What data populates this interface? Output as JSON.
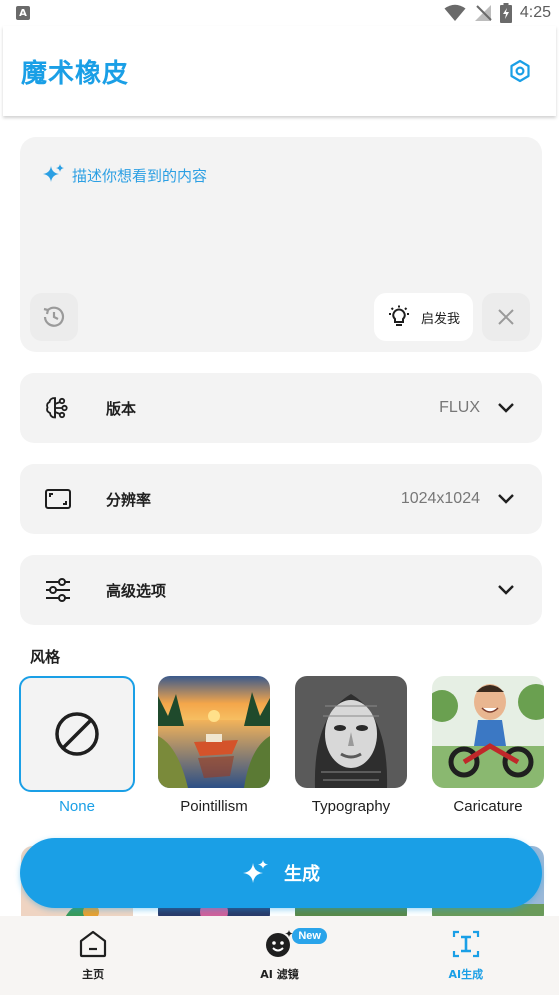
{
  "status_bar": {
    "time": "4:25",
    "notification_letter": "A"
  },
  "app": {
    "title": "魔术橡皮"
  },
  "prompt": {
    "placeholder": "描述你想看到的内容",
    "inspire_label": "启发我"
  },
  "options": [
    {
      "label": "版本",
      "value": "FLUX",
      "icon": "brain-icon"
    },
    {
      "label": "分辨率",
      "value": "1024x1024",
      "icon": "aspect-ratio-icon"
    },
    {
      "label": "高级选项",
      "value": "",
      "icon": "sliders-icon"
    }
  ],
  "styles": {
    "title": "风格",
    "items": [
      {
        "name": "None",
        "selected": true
      },
      {
        "name": "Pointillism",
        "selected": false
      },
      {
        "name": "Typography",
        "selected": false
      },
      {
        "name": "Caricature",
        "selected": false
      }
    ]
  },
  "generate": {
    "label": "生成"
  },
  "bottom_nav": {
    "items": [
      {
        "label": "主页",
        "icon": "home-icon",
        "active": false
      },
      {
        "label": "AI 滤镜",
        "icon": "face-sparkle-icon",
        "active": false,
        "badge": "New"
      },
      {
        "label": "AI生成",
        "icon": "ai-text-icon",
        "active": true
      }
    ]
  },
  "colors": {
    "accent": "#1a9fe6",
    "card_bg": "#f3f3f3",
    "nav_bg": "#f7f5f3"
  }
}
